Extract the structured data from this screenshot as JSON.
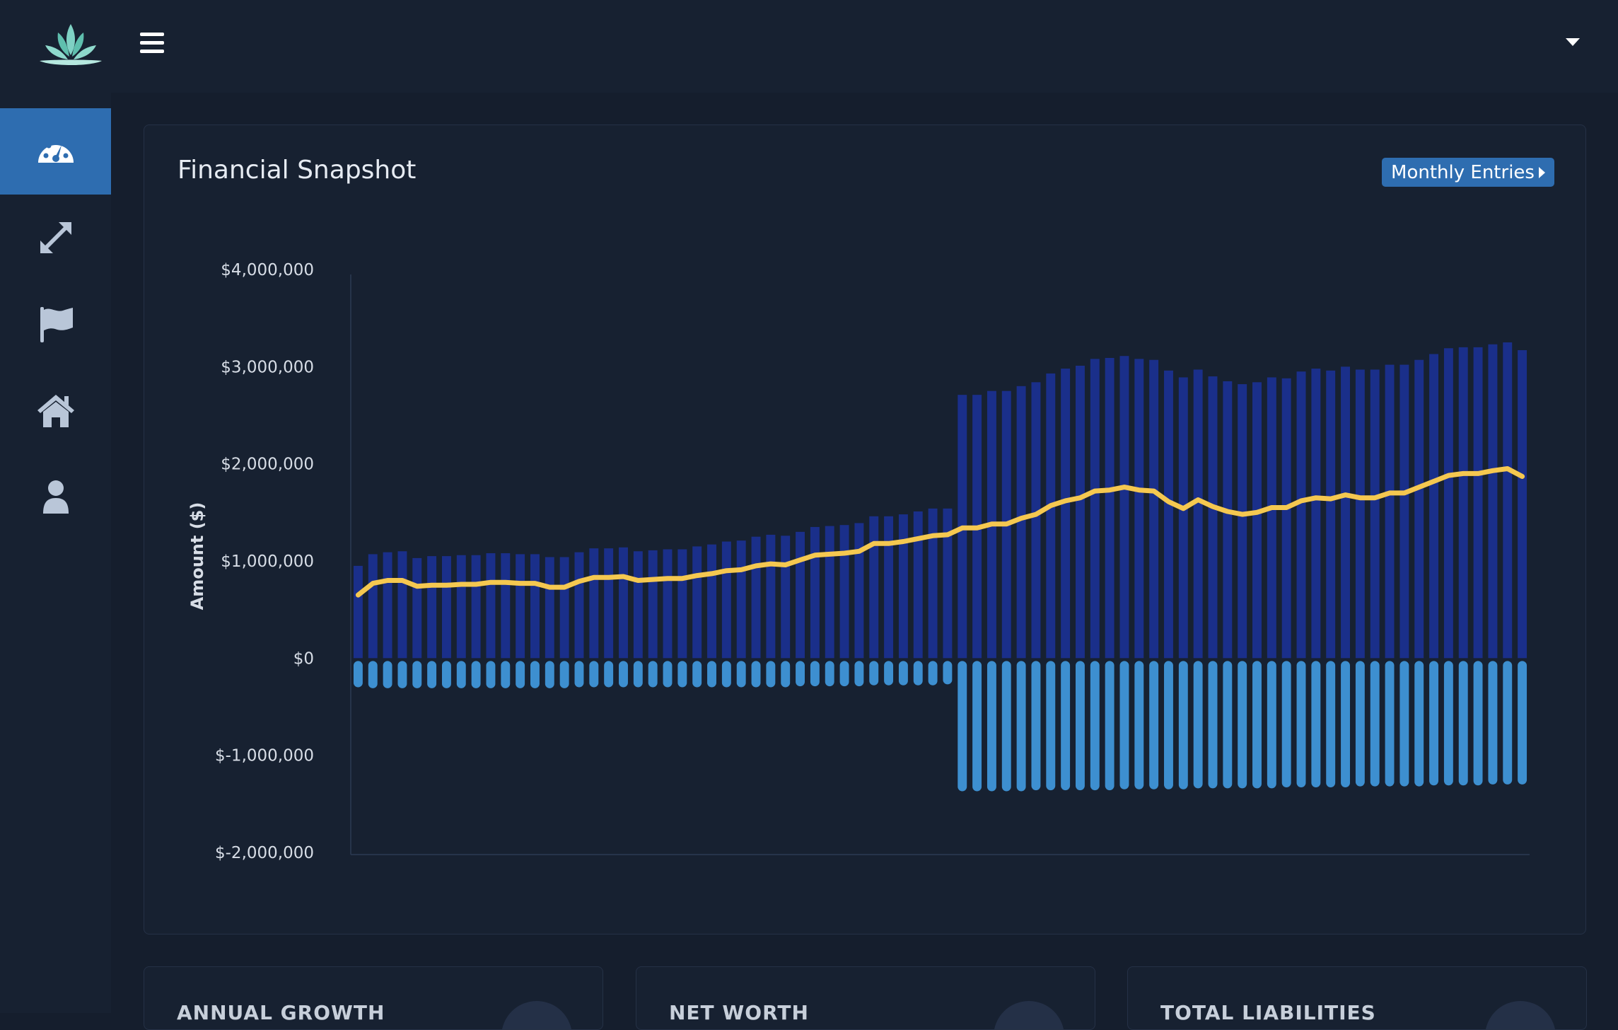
{
  "nav": {
    "logo": "lotus-logo",
    "sidebar_items": [
      {
        "name": "dashboard",
        "icon": "dashboard-gauge-icon",
        "active": true
      },
      {
        "name": "transfers",
        "icon": "expand-arrows-icon",
        "active": false
      },
      {
        "name": "goals",
        "icon": "flag-icon",
        "active": false
      },
      {
        "name": "assets",
        "icon": "home-icon",
        "active": false
      },
      {
        "name": "profile",
        "icon": "user-icon",
        "active": false
      }
    ]
  },
  "card": {
    "title": "Financial Snapshot",
    "button_label": "Monthly Entries"
  },
  "stat_cards": [
    {
      "title": "ANNUAL GROWTH"
    },
    {
      "title": "NET WORTH"
    },
    {
      "title": "TOTAL LIABILITIES"
    }
  ],
  "colors": {
    "assets_bar": "#1a2f8a",
    "liabilities_bar": "#3d8fd0",
    "net_worth_line": "#f5c850",
    "accent": "#2e6db0",
    "background": "#151e2d"
  },
  "chart_data": {
    "type": "bar",
    "ylabel": "Amount ($)",
    "ylim": [
      -2000000,
      4000000
    ],
    "yticks": [
      "$4,000,000",
      "$3,000,000",
      "$2,000,000",
      "$1,000,000",
      "$0",
      "$-1,000,000",
      "$-2,000,000"
    ],
    "grid": false,
    "series": [
      {
        "type": "bar",
        "values": [
          950000,
          1070000,
          1090000,
          1100000,
          1030000,
          1050000,
          1050000,
          1060000,
          1060000,
          1080000,
          1080000,
          1070000,
          1070000,
          1040000,
          1040000,
          1090000,
          1130000,
          1130000,
          1140000,
          1100000,
          1110000,
          1120000,
          1120000,
          1150000,
          1170000,
          1200000,
          1210000,
          1250000,
          1270000,
          1260000,
          1300000,
          1350000,
          1360000,
          1370000,
          1390000,
          1460000,
          1460000,
          1480000,
          1510000,
          1540000,
          1540000,
          2710000,
          2710000,
          2750000,
          2750000,
          2800000,
          2840000,
          2930000,
          2980000,
          3010000,
          3080000,
          3090000,
          3110000,
          3080000,
          3070000,
          2960000,
          2890000,
          2970000,
          2900000,
          2850000,
          2820000,
          2840000,
          2890000,
          2880000,
          2950000,
          2980000,
          2960000,
          3000000,
          2970000,
          2970000,
          3020000,
          3020000,
          3070000,
          3130000,
          3190000,
          3200000,
          3200000,
          3230000,
          3250000,
          3170000
        ]
      },
      {
        "type": "bar",
        "values": [
          -300000,
          -310000,
          -310000,
          -310000,
          -310000,
          -310000,
          -310000,
          -310000,
          -310000,
          -310000,
          -310000,
          -310000,
          -310000,
          -310000,
          -310000,
          -300000,
          -300000,
          -300000,
          -300000,
          -300000,
          -300000,
          -300000,
          -300000,
          -300000,
          -300000,
          -300000,
          -300000,
          -300000,
          -300000,
          -300000,
          -290000,
          -290000,
          -290000,
          -290000,
          -290000,
          -280000,
          -280000,
          -280000,
          -280000,
          -280000,
          -270000,
          -1370000,
          -1370000,
          -1370000,
          -1370000,
          -1370000,
          -1360000,
          -1360000,
          -1360000,
          -1360000,
          -1360000,
          -1360000,
          -1350000,
          -1350000,
          -1350000,
          -1350000,
          -1350000,
          -1340000,
          -1340000,
          -1340000,
          -1340000,
          -1340000,
          -1340000,
          -1330000,
          -1330000,
          -1330000,
          -1330000,
          -1330000,
          -1320000,
          -1320000,
          -1320000,
          -1320000,
          -1320000,
          -1310000,
          -1310000,
          -1310000,
          -1310000,
          -1300000,
          -1300000,
          -1300000
        ]
      },
      {
        "type": "line",
        "values": [
          650000,
          770000,
          800000,
          800000,
          740000,
          750000,
          750000,
          760000,
          760000,
          780000,
          780000,
          770000,
          770000,
          730000,
          730000,
          790000,
          830000,
          830000,
          840000,
          800000,
          810000,
          820000,
          820000,
          850000,
          870000,
          900000,
          910000,
          950000,
          970000,
          960000,
          1010000,
          1060000,
          1070000,
          1080000,
          1100000,
          1180000,
          1180000,
          1200000,
          1230000,
          1260000,
          1270000,
          1340000,
          1340000,
          1380000,
          1380000,
          1440000,
          1480000,
          1570000,
          1620000,
          1650000,
          1720000,
          1730000,
          1760000,
          1730000,
          1720000,
          1610000,
          1540000,
          1630000,
          1560000,
          1510000,
          1480000,
          1500000,
          1550000,
          1550000,
          1620000,
          1650000,
          1640000,
          1680000,
          1650000,
          1650000,
          1700000,
          1700000,
          1760000,
          1820000,
          1880000,
          1900000,
          1900000,
          1930000,
          1950000,
          1870000
        ]
      }
    ]
  }
}
